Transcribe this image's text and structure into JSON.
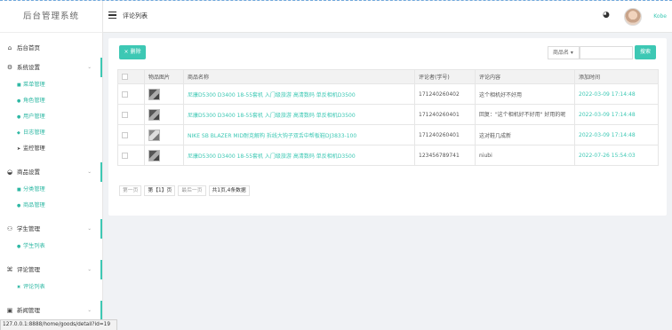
{
  "app": {
    "logo": "后台管理系统"
  },
  "sidebar": {
    "home": "后台首页",
    "system": {
      "label": "系统设置",
      "items": [
        "菜单管理",
        "角色管理",
        "用户管理",
        "日志管理",
        "监控管理"
      ]
    },
    "goods": {
      "label": "商品设置",
      "items": [
        "分类管理",
        "商品管理"
      ]
    },
    "students": {
      "label": "学生管理",
      "items": [
        "学生列表"
      ]
    },
    "comments": {
      "label": "评论管理",
      "items": [
        "评论列表"
      ]
    },
    "news": {
      "label": "新闻管理"
    }
  },
  "topbar": {
    "title": "评论列表",
    "username": "Kobe"
  },
  "toolbar": {
    "delete_label": "× 删除",
    "search_field": "商品名 ▾",
    "search_placeholder": "",
    "search_label": "搜索"
  },
  "table": {
    "headers": [
      "物品图片",
      "商品名称",
      "评论者(学号)",
      "评论内容",
      "添加时间"
    ],
    "rows": [
      {
        "name": "尼康D5300 D3400 18-55套机 入门级旅游 高清数码 单反相机D3500",
        "user": "171240260402",
        "content": "这个相机好不好用",
        "time": "2022-03-09 17:14:48"
      },
      {
        "name": "尼康D5300 D3400 18-55套机 入门级旅游 高清数码 单反相机D3500",
        "user": "171240260401",
        "content": "回复：\"这个相机好不好用\" 好用的呢",
        "time": "2022-03-09 17:14:48"
      },
      {
        "name": "NIKE SB BLAZER MID耐克解构 拆线大钩子双舌中帮板鞋DJ3833-100",
        "user": "171240260401",
        "content": "这对鞋几成新",
        "time": "2022-03-09 17:14:48"
      },
      {
        "name": "尼康D5300 D3400 18-55套机 入门级旅游 高清数码 单反相机D3500",
        "user": "123456789741",
        "content": "niubi",
        "time": "2022-07-26 15:54:03"
      }
    ]
  },
  "pagination": {
    "first": "第一页",
    "current": "第【1】页",
    "last": "最后一页",
    "total": "共1页,4条数据"
  },
  "statusbar": {
    "url": "127.0.0.1:8888/home/goods/detail?id=19"
  },
  "colors": {
    "accent": "#3dc8b4"
  }
}
